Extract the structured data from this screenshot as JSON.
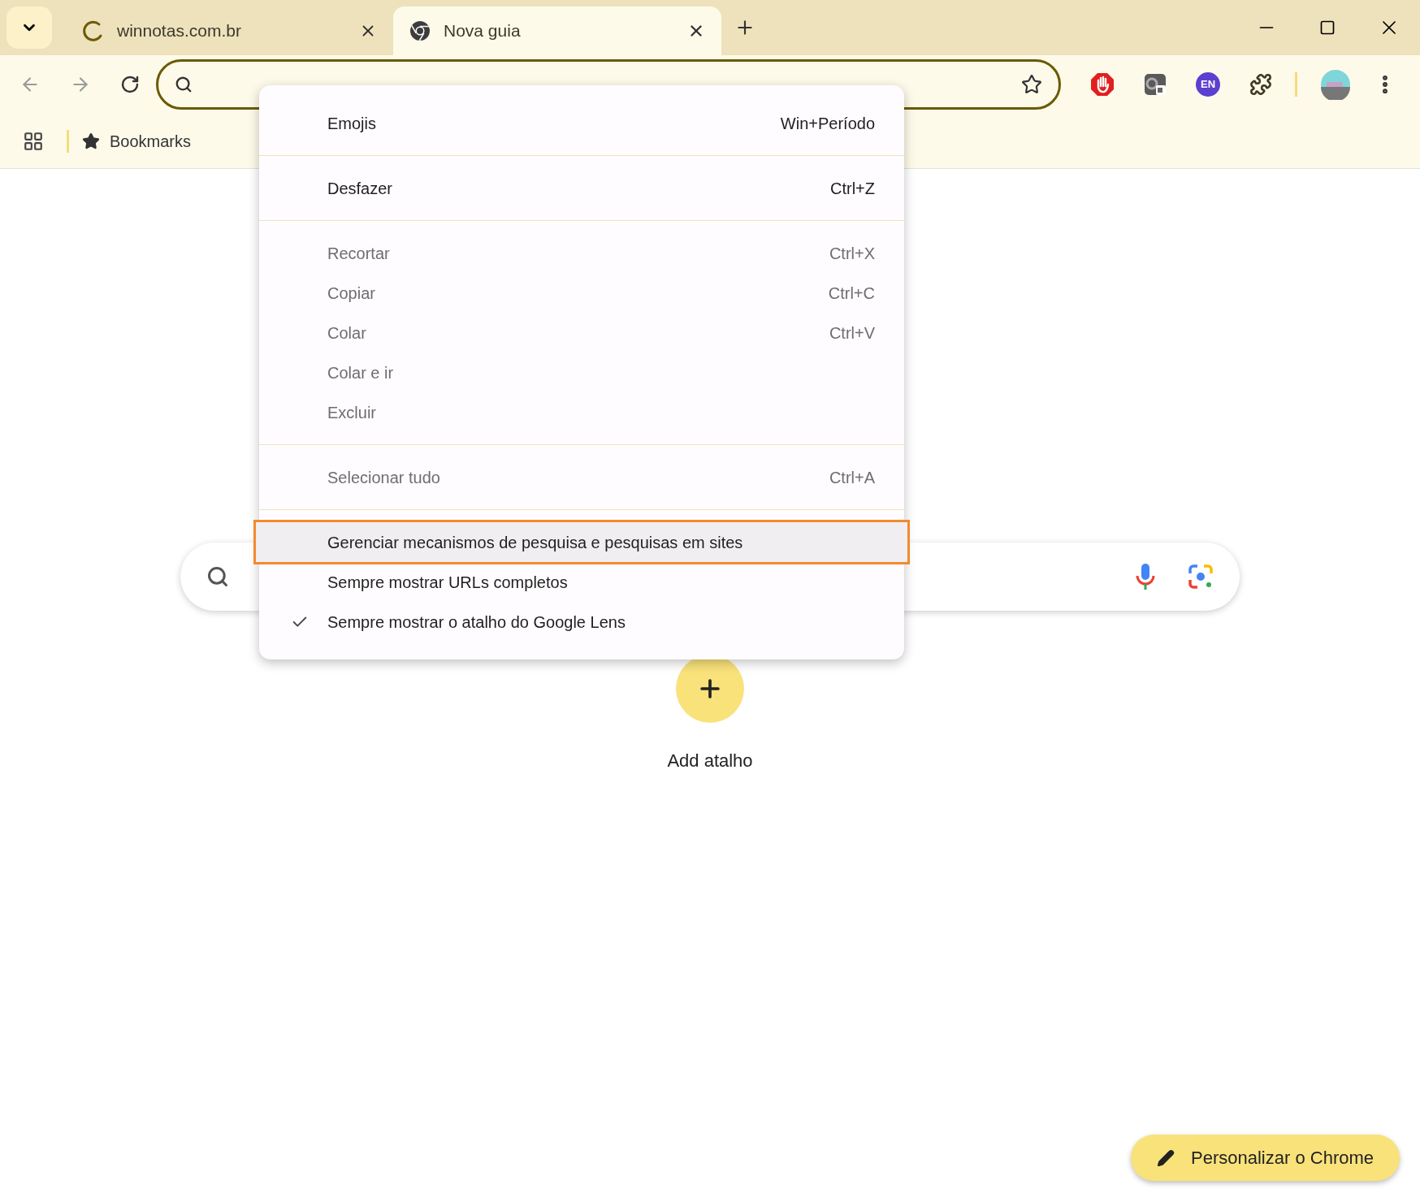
{
  "tabs": [
    {
      "title": "winnotas.com.br",
      "selected": false,
      "loading": true
    },
    {
      "title": "Nova guia",
      "selected": true,
      "loading": false
    }
  ],
  "extensions": {
    "language_badge": "EN"
  },
  "bookmarks_bar": {
    "items": [
      "Bookmarks"
    ]
  },
  "context_menu": {
    "sections": [
      [
        {
          "label": "Emojis",
          "shortcut": "Win+Período",
          "disabled": false,
          "checked": false,
          "selected": false
        }
      ],
      [
        {
          "label": "Desfazer",
          "shortcut": "Ctrl+Z",
          "disabled": false,
          "checked": false,
          "selected": false
        }
      ],
      [
        {
          "label": "Recortar",
          "shortcut": "Ctrl+X",
          "disabled": true,
          "checked": false,
          "selected": false
        },
        {
          "label": "Copiar",
          "shortcut": "Ctrl+C",
          "disabled": true,
          "checked": false,
          "selected": false
        },
        {
          "label": "Colar",
          "shortcut": "Ctrl+V",
          "disabled": true,
          "checked": false,
          "selected": false
        },
        {
          "label": "Colar e ir",
          "disabled": true,
          "checked": false,
          "selected": false
        },
        {
          "label": "Excluir",
          "disabled": true,
          "checked": false,
          "selected": false
        }
      ],
      [
        {
          "label": "Selecionar tudo",
          "shortcut": "Ctrl+A",
          "disabled": true,
          "checked": false,
          "selected": false
        }
      ],
      [
        {
          "label": "Gerenciar mecanismos de pesquisa e pesquisas em sites",
          "disabled": false,
          "checked": false,
          "selected": true
        },
        {
          "label": "Sempre mostrar URLs completos",
          "disabled": false,
          "checked": false,
          "selected": false
        },
        {
          "label": "Sempre mostrar o atalho do Google Lens",
          "disabled": false,
          "checked": true,
          "selected": false
        }
      ]
    ]
  },
  "shortcuts": [
    {
      "label": "Add atalho"
    }
  ],
  "customize_button": "Personalizar o Chrome"
}
